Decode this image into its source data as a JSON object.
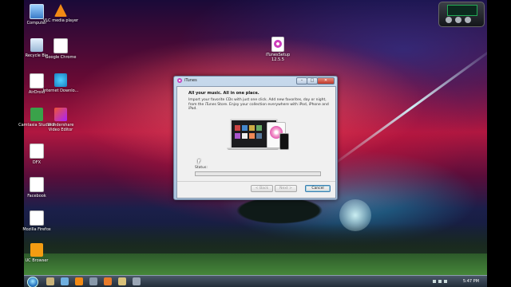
{
  "desktop": {
    "icons": [
      {
        "label": "Computer"
      },
      {
        "label": "VLC media player"
      },
      {
        "label": "Recycle Bin"
      },
      {
        "label": "Google Chrome"
      },
      {
        "label": "AirDroid"
      },
      {
        "label": "Internet Downlo..."
      },
      {
        "label": "Camtasia Studio 8"
      },
      {
        "label": "Wondershare Video Editor"
      },
      {
        "label": "DFX"
      },
      {
        "label": "Facebook"
      },
      {
        "label": "Mozilla Firefox"
      },
      {
        "label": "UC Browser"
      }
    ],
    "itunes_setup_icon": {
      "label": "iTunesSetup 12.5.5"
    }
  },
  "window": {
    "title": "iTunes",
    "heading": "All your music. All in one place.",
    "body": "Import your favorite CDs with just one click. Add new favorites, day or night, from the iTunes Store. Enjoy your collection everywhere with iPod, iPhone and iPad.",
    "status_label": "Status:",
    "progress_fraction": 0.0,
    "buttons": {
      "back": "< Back",
      "next": "Next >",
      "cancel": "Cancel"
    },
    "title_buttons": {
      "minimize": "–",
      "maximize": "□",
      "close": "✕"
    }
  },
  "taskbar": {
    "clock": "5:47 PM",
    "pinned": [
      "explorer-icon",
      "media-icon",
      "vlc-icon",
      "monitor-icon",
      "firefox-icon",
      "folder-icon",
      "settings-icon"
    ]
  },
  "colors": {
    "accent": "#3c7fb1",
    "progress": "#2ea42e"
  }
}
